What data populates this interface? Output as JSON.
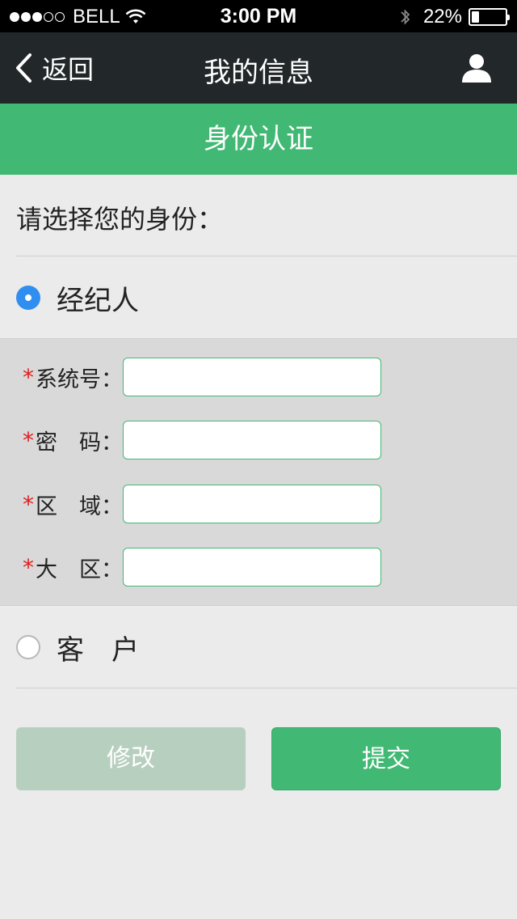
{
  "status_bar": {
    "signal_filled": 3,
    "signal_total": 5,
    "carrier": "BELL",
    "time": "3:00 PM",
    "battery_text": "22%",
    "battery_level": 0.22,
    "icons": [
      "wifi-icon",
      "bluetooth-icon",
      "battery-icon"
    ]
  },
  "nav": {
    "back_label": "返回",
    "title": "我的信息",
    "back_icon": "chevron-left-icon",
    "profile_icon": "user-icon"
  },
  "banner": {
    "title": "身份认证"
  },
  "form": {
    "prompt": "请选择您的身份：",
    "option_agent": {
      "label": "经纪人",
      "selected": true
    },
    "option_customer": {
      "label": "客　户",
      "selected": false
    },
    "required_mark": "*",
    "fields": [
      {
        "label": "系统号：",
        "value": ""
      },
      {
        "label": "密　码：",
        "value": ""
      },
      {
        "label": "区　域：",
        "value": ""
      },
      {
        "label": "大　区：",
        "value": ""
      }
    ]
  },
  "actions": {
    "edit_label": "修改",
    "submit_label": "提交"
  },
  "colors": {
    "accent_green": "#41b974",
    "nav_bg": "#22272a",
    "radio_blue": "#2f8ef0",
    "required_red": "#e02020",
    "disabled_green": "#b7cfbf"
  }
}
